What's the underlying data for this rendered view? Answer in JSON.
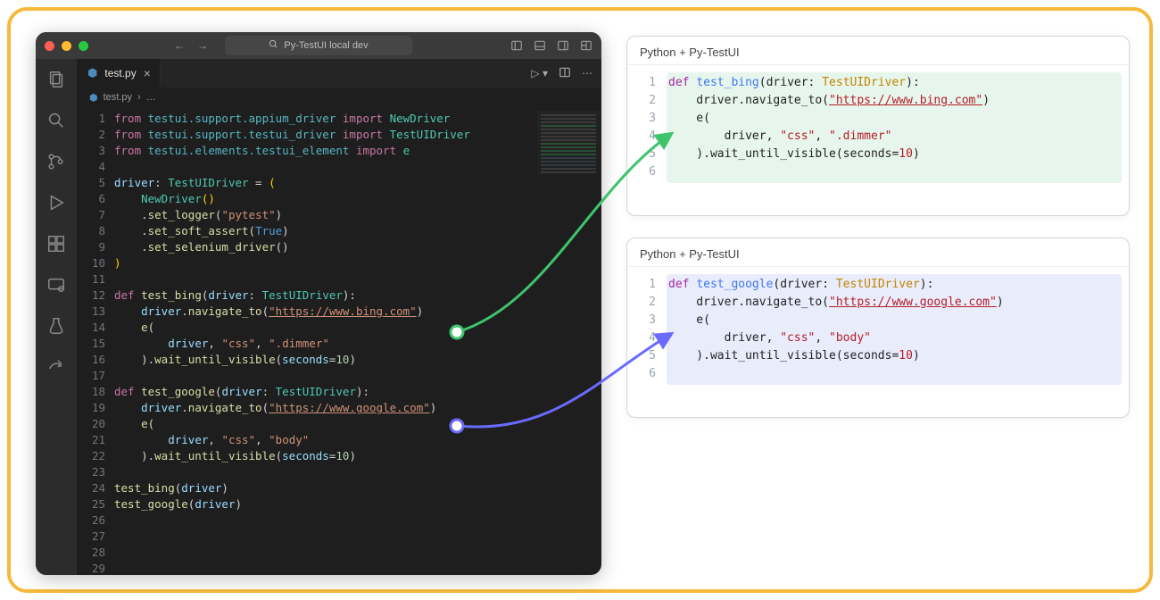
{
  "window": {
    "search_label": "Py-TestUI local dev",
    "tab_filename": "test.py",
    "breadcrumb_file": "test.py",
    "breadcrumb_rest": "…"
  },
  "activity_icons": [
    "files",
    "search",
    "source-control",
    "debug",
    "extensions",
    "remote",
    "testing",
    "share"
  ],
  "editor_lines": [
    {
      "n": 1,
      "cls": "",
      "html": "<span class='token-kw'>from</span> <span class='token-mod'>testui.support.appium_driver</span> <span class='token-kw'>import</span> <span class='token-ty'>NewDriver</span>"
    },
    {
      "n": 2,
      "cls": "",
      "html": "<span class='token-kw'>from</span> <span class='token-mod'>testui.support.testui_driver</span> <span class='token-kw'>import</span> <span class='token-ty'>TestUIDriver</span>"
    },
    {
      "n": 3,
      "cls": "",
      "html": "<span class='token-kw'>from</span> <span class='token-mod'>testui.elements.testui_element</span> <span class='token-kw'>import</span> <span class='token-ty'>e</span>"
    },
    {
      "n": 4,
      "cls": "",
      "html": ""
    },
    {
      "n": 5,
      "cls": "",
      "html": "<span class='token-id'>driver</span>: <span class='token-ty'>TestUIDriver</span> = <span class='token-brk'>(</span>"
    },
    {
      "n": 6,
      "cls": "",
      "html": "    <span class='token-ty'>NewDriver</span><span class='token-brk'>()</span>"
    },
    {
      "n": 7,
      "cls": "",
      "html": "    .<span class='token-fn'>set_logger</span>(<span class='token-str'>\"pytest\"</span>)"
    },
    {
      "n": 8,
      "cls": "",
      "html": "    .<span class='token-fn'>set_soft_assert</span>(<span class='token-const'>True</span>)"
    },
    {
      "n": 9,
      "cls": "",
      "html": "    .<span class='token-fn'>set_selenium_driver</span>()"
    },
    {
      "n": 10,
      "cls": "",
      "html": "<span class='token-brk'>)</span>"
    },
    {
      "n": 11,
      "cls": "",
      "html": ""
    },
    {
      "n": 12,
      "cls": "hl-g",
      "html": "<span class='token-kw'>def</span> <span class='token-fn'>test_bing</span>(<span class='token-id'>driver</span>: <span class='token-ty'>TestUIDriver</span>):"
    },
    {
      "n": 13,
      "cls": "hl-g",
      "html": "    <span class='token-id'>driver</span>.<span class='token-fn'>navigate_to</span>(<span class='token-str u'>\"https://www.bing.com\"</span>)"
    },
    {
      "n": 14,
      "cls": "hl-g",
      "html": "    <span class='token-fn'>e</span>("
    },
    {
      "n": 15,
      "cls": "hl-g",
      "html": "        <span class='token-id'>driver</span>, <span class='token-str'>\"css\"</span>, <span class='token-str'>\".dimmer\"</span>"
    },
    {
      "n": 16,
      "cls": "hl-g",
      "html": "    ).<span class='token-fn'>wait_until_visible</span>(<span class='token-id'>seconds</span>=<span class='token-num'>10</span>)"
    },
    {
      "n": 17,
      "cls": "",
      "html": ""
    },
    {
      "n": 18,
      "cls": "hl-b",
      "html": "<span class='token-kw'>def</span> <span class='token-fn'>test_google</span>(<span class='token-id'>driver</span>: <span class='token-ty'>TestUIDriver</span>):"
    },
    {
      "n": 19,
      "cls": "hl-b",
      "html": "    <span class='token-id'>driver</span>.<span class='token-fn'>navigate_to</span>(<span class='token-str u'>\"https://www.google.com\"</span>)"
    },
    {
      "n": 20,
      "cls": "hl-b",
      "html": "    <span class='token-fn'>e</span>("
    },
    {
      "n": 21,
      "cls": "hl-b",
      "html": "        <span class='token-id'>driver</span>, <span class='token-str'>\"css\"</span>, <span class='token-str'>\"body\"</span>"
    },
    {
      "n": 22,
      "cls": "hl-b",
      "html": "    ).<span class='token-fn'>wait_until_visible</span>(<span class='token-id'>seconds</span>=<span class='token-num'>10</span>)"
    },
    {
      "n": 23,
      "cls": "",
      "html": ""
    },
    {
      "n": 24,
      "cls": "",
      "html": "<span class='token-fn'>test_bing</span>(<span class='token-id'>driver</span>)"
    },
    {
      "n": 25,
      "cls": "",
      "html": "<span class='token-fn'>test_google</span>(<span class='token-id'>driver</span>)"
    },
    {
      "n": 26,
      "cls": "",
      "html": ""
    },
    {
      "n": 27,
      "cls": "",
      "html": ""
    },
    {
      "n": 28,
      "cls": "",
      "html": ""
    },
    {
      "n": 29,
      "cls": "",
      "html": ""
    }
  ],
  "cards": {
    "green": {
      "title": "Python + Py-TestUI",
      "lines": [
        {
          "n": 1,
          "html": "<span class='ct-kw'>def</span> <span class='ct-fn'>test_bing</span>(driver: <span class='ct-ty'>TestUIDriver</span>):"
        },
        {
          "n": 2,
          "html": "    driver.navigate_to(<span class='ct-str ct-u'>\"https://www.bing.com\"</span>)"
        },
        {
          "n": 3,
          "html": "    e("
        },
        {
          "n": 4,
          "html": "        driver, <span class='ct-str'>\"css\"</span>, <span class='ct-str'>\".dimmer\"</span>"
        },
        {
          "n": 5,
          "html": "    ).wait_until_visible(seconds=<span class='ct-num'>10</span>)"
        },
        {
          "n": 6,
          "html": ""
        }
      ]
    },
    "blue": {
      "title": "Python + Py-TestUI",
      "lines": [
        {
          "n": 1,
          "html": "<span class='ct-kw'>def</span> <span class='ct-fn'>test_google</span>(driver: <span class='ct-ty'>TestUIDriver</span>):"
        },
        {
          "n": 2,
          "html": "    driver.navigate_to(<span class='ct-str ct-u'>\"https://www.google.com\"</span>)"
        },
        {
          "n": 3,
          "html": "    e("
        },
        {
          "n": 4,
          "html": "        driver, <span class='ct-str'>\"css\"</span>, <span class='ct-str'>\"body\"</span>"
        },
        {
          "n": 5,
          "html": "    ).wait_until_visible(seconds=<span class='ct-num'>10</span>)"
        },
        {
          "n": 6,
          "html": ""
        }
      ]
    }
  }
}
